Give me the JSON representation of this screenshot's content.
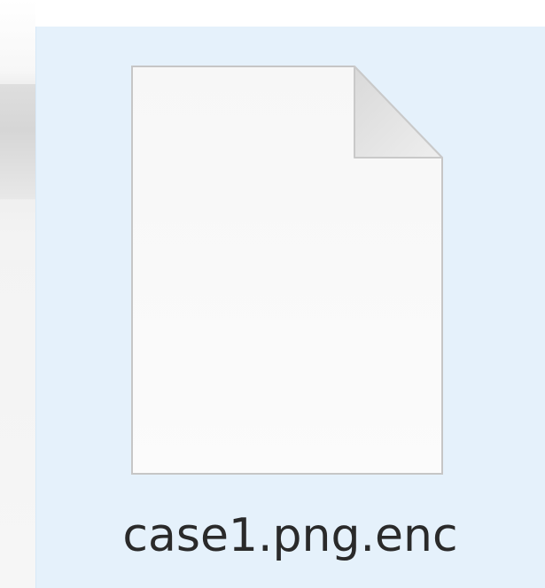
{
  "file": {
    "name": "case1.png.enc",
    "icon": "blank-document-icon",
    "selected": true
  },
  "colors": {
    "selection_background": "#e5f1fb",
    "page_fill": "#f9f9f9",
    "page_outline": "#c9c9c9",
    "folded_corner": "#e2e2e2",
    "label_text": "#2a2a2a"
  }
}
